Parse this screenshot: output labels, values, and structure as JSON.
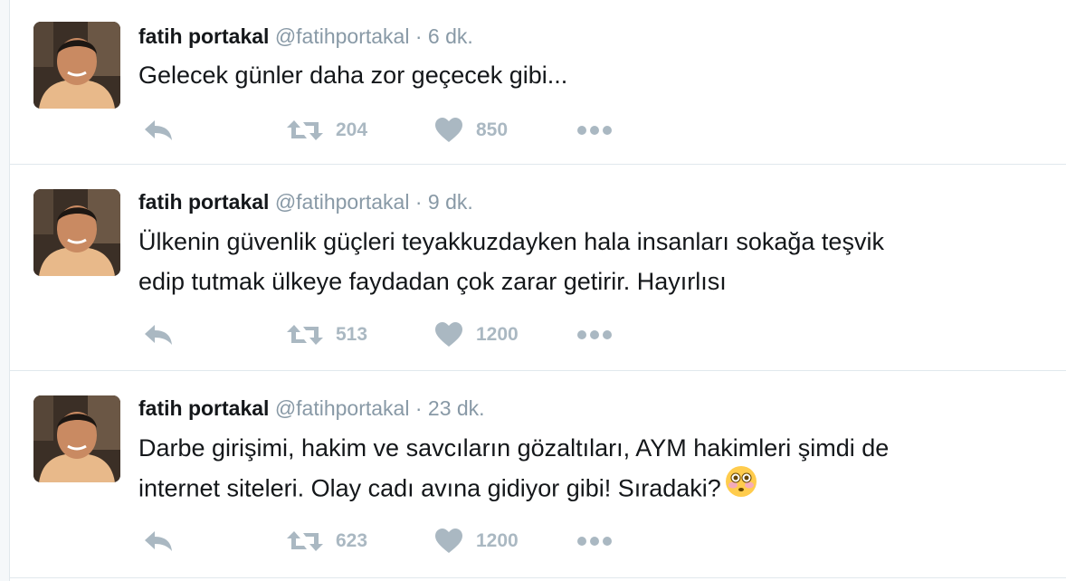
{
  "tweets": [
    {
      "name": "fatih portakal",
      "handle": "@fatihportakal",
      "separator": "·",
      "time": "6 dk.",
      "lines": [
        "Gelecek günler daha zor geçecek gibi..."
      ],
      "retweets": "204",
      "likes": "850"
    },
    {
      "name": "fatih portakal",
      "handle": "@fatihportakal",
      "separator": "·",
      "time": "9 dk.",
      "lines": [
        "Ülkenin güvenlik güçleri teyakkuzdayken hala insanları sokağa teşvik",
        "edip tutmak ülkeye faydadan çok zarar getirir. Hayırlısı"
      ],
      "retweets": "513",
      "likes": "1200"
    },
    {
      "name": "fatih portakal",
      "handle": "@fatihportakal",
      "separator": "·",
      "time": "23 dk.",
      "lines": [
        "Darbe girişimi, hakim ve savcıların gözaltıları, AYM hakimleri şimdi de",
        "internet siteleri. Olay cadı avına gidiyor gibi! Sıradaki?"
      ],
      "emoji": "flushed-face",
      "retweets": "623",
      "likes": "1200"
    }
  ],
  "icons": {
    "reply": "reply-icon",
    "retweet": "retweet-icon",
    "like": "heart-icon",
    "more": "more-dots-icon"
  },
  "colors": {
    "text": "#14171a",
    "secondary": "#8899a6",
    "action": "#aab8c2",
    "border": "#e1e8ed"
  }
}
